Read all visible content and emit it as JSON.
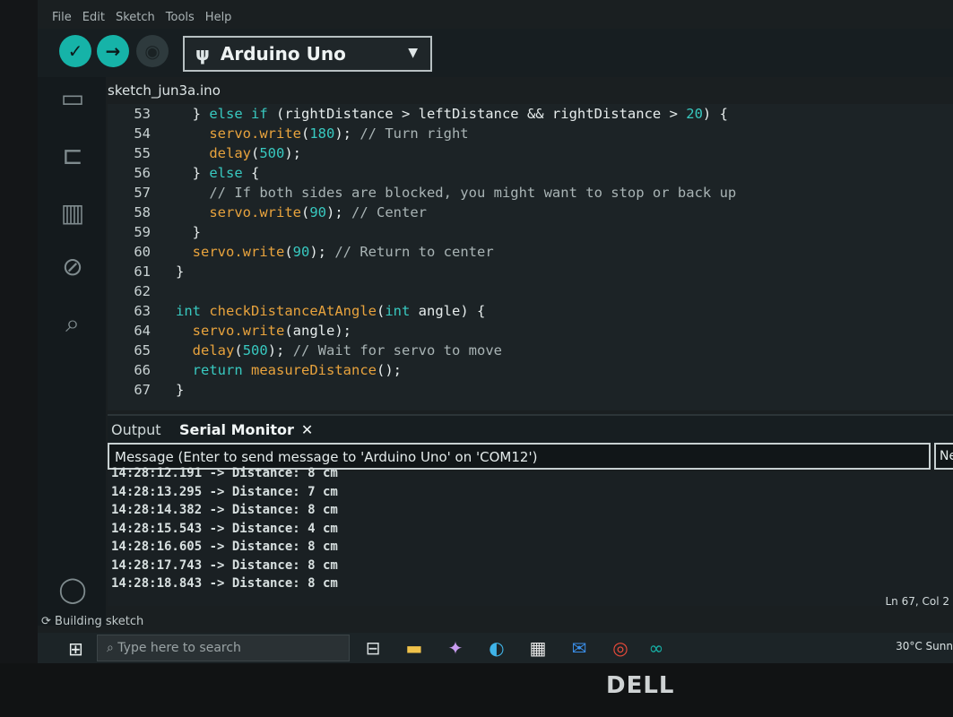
{
  "menu": [
    "File",
    "Edit",
    "Sketch",
    "Tools",
    "Help"
  ],
  "board": {
    "name": "Arduino Uno"
  },
  "tab": {
    "filename": "sketch_jun3a.ino"
  },
  "code_lines": [
    {
      "n": "53",
      "segments": [
        {
          "t": "  } ",
          "c": ""
        },
        {
          "t": "else if",
          "c": "kw"
        },
        {
          "t": " (rightDistance > leftDistance && rightDistance > ",
          "c": ""
        },
        {
          "t": "20",
          "c": "num"
        },
        {
          "t": ") {",
          "c": ""
        }
      ]
    },
    {
      "n": "54",
      "segments": [
        {
          "t": "    ",
          "c": ""
        },
        {
          "t": "servo.write",
          "c": "fn"
        },
        {
          "t": "(",
          "c": ""
        },
        {
          "t": "180",
          "c": "num"
        },
        {
          "t": "); ",
          "c": ""
        },
        {
          "t": "// Turn right",
          "c": "cm"
        }
      ]
    },
    {
      "n": "55",
      "segments": [
        {
          "t": "    ",
          "c": ""
        },
        {
          "t": "delay",
          "c": "fn"
        },
        {
          "t": "(",
          "c": ""
        },
        {
          "t": "500",
          "c": "num"
        },
        {
          "t": ");",
          "c": ""
        }
      ]
    },
    {
      "n": "56",
      "segments": [
        {
          "t": "  } ",
          "c": ""
        },
        {
          "t": "else",
          "c": "kw"
        },
        {
          "t": " {",
          "c": ""
        }
      ]
    },
    {
      "n": "57",
      "segments": [
        {
          "t": "    ",
          "c": ""
        },
        {
          "t": "// If both sides are blocked, you might want to stop or back up",
          "c": "cm"
        }
      ]
    },
    {
      "n": "58",
      "segments": [
        {
          "t": "    ",
          "c": ""
        },
        {
          "t": "servo.write",
          "c": "fn"
        },
        {
          "t": "(",
          "c": ""
        },
        {
          "t": "90",
          "c": "num"
        },
        {
          "t": "); ",
          "c": ""
        },
        {
          "t": "// Center",
          "c": "cm"
        }
      ]
    },
    {
      "n": "59",
      "segments": [
        {
          "t": "  }",
          "c": ""
        }
      ]
    },
    {
      "n": "60",
      "segments": [
        {
          "t": "  ",
          "c": ""
        },
        {
          "t": "servo.write",
          "c": "fn"
        },
        {
          "t": "(",
          "c": ""
        },
        {
          "t": "90",
          "c": "num"
        },
        {
          "t": "); ",
          "c": ""
        },
        {
          "t": "// Return to center",
          "c": "cm"
        }
      ]
    },
    {
      "n": "61",
      "segments": [
        {
          "t": "}",
          "c": ""
        }
      ]
    },
    {
      "n": "62",
      "segments": [
        {
          "t": "",
          "c": ""
        }
      ]
    },
    {
      "n": "63",
      "segments": [
        {
          "t": "int",
          "c": "kw"
        },
        {
          "t": " ",
          "c": ""
        },
        {
          "t": "checkDistanceAtAngle",
          "c": "fn"
        },
        {
          "t": "(",
          "c": ""
        },
        {
          "t": "int",
          "c": "kw"
        },
        {
          "t": " angle) {",
          "c": ""
        }
      ]
    },
    {
      "n": "64",
      "segments": [
        {
          "t": "  ",
          "c": ""
        },
        {
          "t": "servo.write",
          "c": "fn"
        },
        {
          "t": "(angle);",
          "c": ""
        }
      ]
    },
    {
      "n": "65",
      "segments": [
        {
          "t": "  ",
          "c": ""
        },
        {
          "t": "delay",
          "c": "fn"
        },
        {
          "t": "(",
          "c": ""
        },
        {
          "t": "500",
          "c": "num"
        },
        {
          "t": "); ",
          "c": ""
        },
        {
          "t": "// Wait for servo to move",
          "c": "cm"
        }
      ]
    },
    {
      "n": "66",
      "segments": [
        {
          "t": "  ",
          "c": ""
        },
        {
          "t": "return",
          "c": "kw"
        },
        {
          "t": " ",
          "c": ""
        },
        {
          "t": "measureDistance",
          "c": "fn"
        },
        {
          "t": "();",
          "c": ""
        }
      ]
    },
    {
      "n": "67",
      "segments": [
        {
          "t": "}",
          "c": ""
        }
      ]
    }
  ],
  "panel": {
    "tabs": [
      "Output",
      "Serial Monitor"
    ],
    "close_glyph": "✕"
  },
  "message": {
    "placeholder": "Message (Enter to send message to 'Arduino Uno' on 'COM12')",
    "newline_label": "Ne"
  },
  "serial_lines": [
    "14:28:12.191 -> Distance: 8 cm",
    "14:28:13.295 -> Distance: 7 cm",
    "14:28:14.382 -> Distance: 8 cm",
    "14:28:15.543 -> Distance: 4 cm",
    "14:28:16.605 -> Distance: 8 cm",
    "14:28:17.743 -> Distance: 8 cm",
    "14:28:18.843 -> Distance: 8 cm"
  ],
  "status": {
    "position": "Ln 67, Col 2",
    "building": "Building sketch"
  },
  "taskbar": {
    "search_placeholder": "Type here to search",
    "weather": "30°C Sunn"
  },
  "brand": "DELL",
  "colors": {
    "accent": "#16b3a8",
    "keyword": "#38c9c0",
    "function": "#e8a33d"
  }
}
